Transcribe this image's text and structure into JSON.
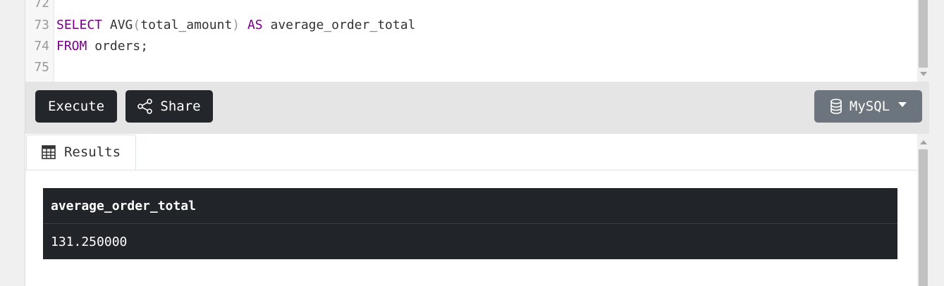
{
  "editor": {
    "lines": [
      {
        "number": "72",
        "tokens": []
      },
      {
        "number": "73",
        "tokens": [
          {
            "text": "SELECT",
            "kind": "kw"
          },
          {
            "text": " AVG",
            "kind": "fn"
          },
          {
            "text": "(",
            "kind": "pn"
          },
          {
            "text": "total_amount",
            "kind": "fn"
          },
          {
            "text": ")",
            "kind": "pn"
          },
          {
            "text": " AS",
            "kind": "kw"
          },
          {
            "text": " average_order_total",
            "kind": "fn"
          }
        ]
      },
      {
        "number": "74",
        "tokens": [
          {
            "text": "FROM",
            "kind": "kw"
          },
          {
            "text": " orders;",
            "kind": "fn"
          }
        ]
      },
      {
        "number": "75",
        "tokens": []
      }
    ]
  },
  "toolbar": {
    "execute_label": "Execute",
    "share_label": "Share",
    "db_label": "MySQL"
  },
  "results": {
    "tab_label": "Results",
    "columns": [
      "average_order_total"
    ],
    "rows": [
      [
        "131.250000"
      ]
    ]
  },
  "colors": {
    "keyword": "#770088",
    "button_dark": "#23272b",
    "button_secondary": "#6c757d",
    "table_bg": "#212529"
  },
  "icons": {
    "share": "share-icon",
    "database": "database-icon",
    "table": "table-icon"
  }
}
